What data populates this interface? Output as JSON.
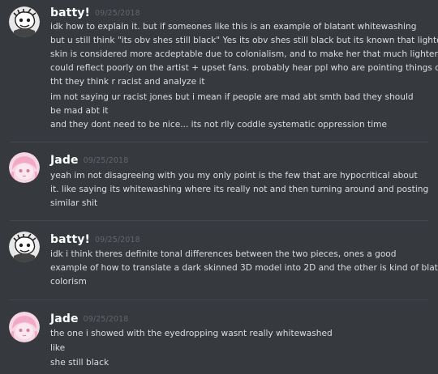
{
  "messages": [
    {
      "username": "batty!",
      "timestamp": "09/25/2018",
      "lines": [
        "idk how to explain it. but if someones like this is an example of blatant whitewashing",
        "but u still think \"its obv shes still black\" Yes its obv shes still black but its known that lighter",
        "skin is considered more acdeptable due to colonialism, and to make her that much lighter",
        "could reflect poorly on the artist + upset fans. probably hear ppl who are pointing things out",
        "tht they think r racist and analyze it",
        "im not saying ur racist jones but i mean if people are mad abt smth bad they should",
        "be mad abt it",
        "and they dont need to be nice... its not rlly coddle systematic oppression time"
      ]
    },
    {
      "username": "Jade",
      "timestamp": "09/25/2018",
      "lines": [
        "yeah im not disagreeing with you my only point is the few that are hypocritical about",
        "it. like saying its whitewashing where its really not and then turning around and posting",
        "similar shit"
      ]
    },
    {
      "username": "batty!",
      "timestamp": "09/25/2018",
      "lines": [
        "idk i think theres definite tonal differences between the two pieces, ones a good",
        "example of how to translate a dark skinned 3D model into 2D and the other is kind of blatant",
        "colorism"
      ]
    },
    {
      "username": "Jade",
      "timestamp": "09/25/2018",
      "lines": [
        "the one i showed with the eyedropping wasnt really whitewashed",
        "like",
        "she still black"
      ]
    }
  ],
  "colors": {
    "background": "#36393e",
    "username": "#ffffff",
    "message_text": "#dcddde",
    "timestamp": "#62656b"
  },
  "icons": {
    "batty_avatar": "cartoon-character-avatar-icon",
    "jade_avatar": "pink-anime-avatar-icon"
  }
}
